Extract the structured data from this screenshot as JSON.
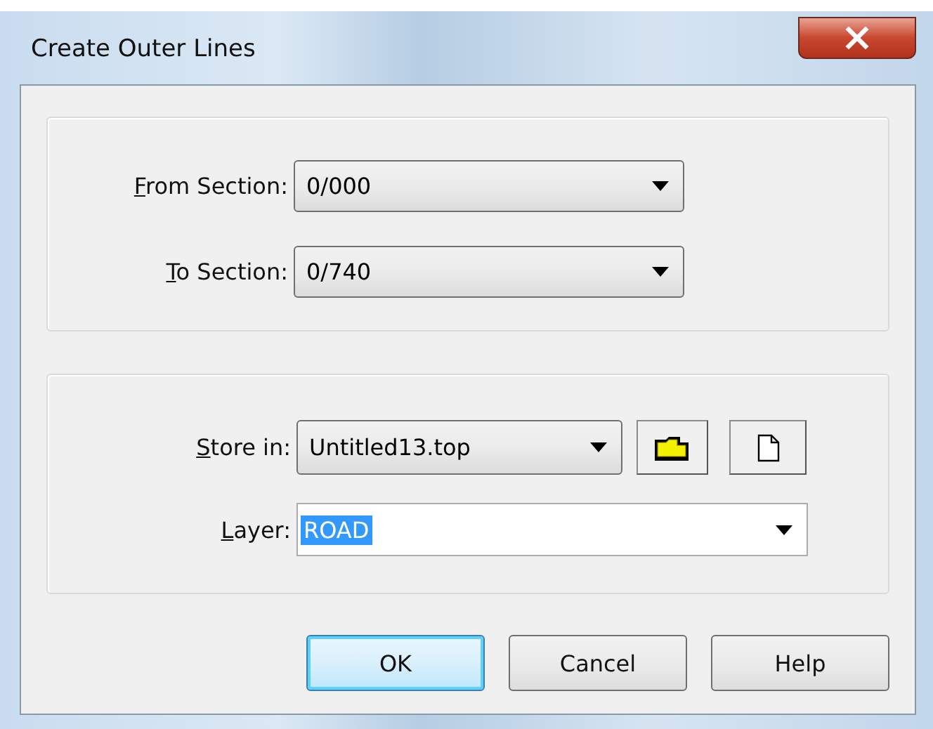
{
  "window": {
    "title": "Create Outer Lines"
  },
  "sections": [
    {
      "accel": "F",
      "label_rest": "rom Section:",
      "value": "0/000"
    },
    {
      "accel": "T",
      "label_rest": "o Section:",
      "value": "0/740"
    }
  ],
  "store": {
    "accel": "S",
    "label_rest": "tore in:",
    "value": "Untitled13.top"
  },
  "layer": {
    "accel": "L",
    "label_rest": "ayer:",
    "value": "ROAD",
    "text_selected": true
  },
  "buttons": [
    {
      "label": "OK",
      "default": true
    },
    {
      "label": "Cancel",
      "default": false
    },
    {
      "label": "Help",
      "default": false
    }
  ]
}
